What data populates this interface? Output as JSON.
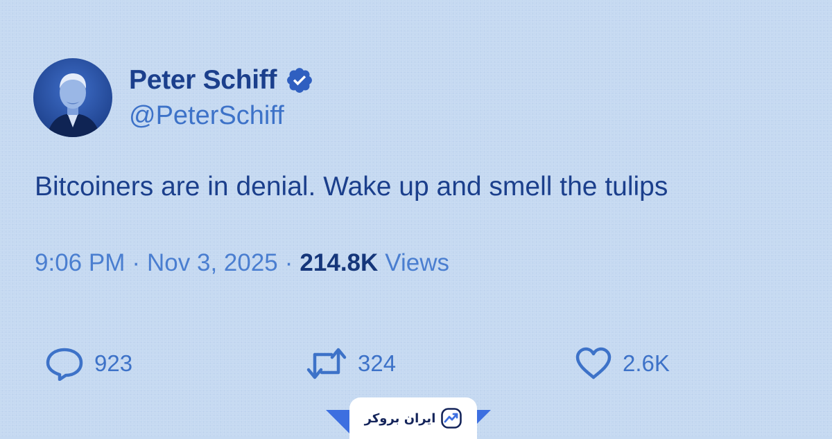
{
  "colors": {
    "background": "#c5d9f1",
    "name": "#1b3f8c",
    "secondary": "#4a7ed0",
    "brand_accent": "#3d6fe0"
  },
  "author": {
    "name": "Peter Schiff",
    "handle": "@PeterSchiff",
    "verified": true
  },
  "tweet": {
    "text": "Bitcoiners are in denial. Wake up and smell the tulips"
  },
  "meta": {
    "time": "9:06 PM",
    "separator": "·",
    "date": "Nov 3, 2025",
    "views_count": "214.8K",
    "views_label": "Views"
  },
  "actions": {
    "replies": "923",
    "retweets": "324",
    "likes": "2.6K"
  },
  "icons": {
    "verified": "verified-badge-icon",
    "reply": "speech-bubble-icon",
    "retweet": "retweet-arrows-icon",
    "like": "heart-icon",
    "brand": "trending-chart-icon"
  },
  "brand": {
    "name": "ایران بروکر"
  }
}
